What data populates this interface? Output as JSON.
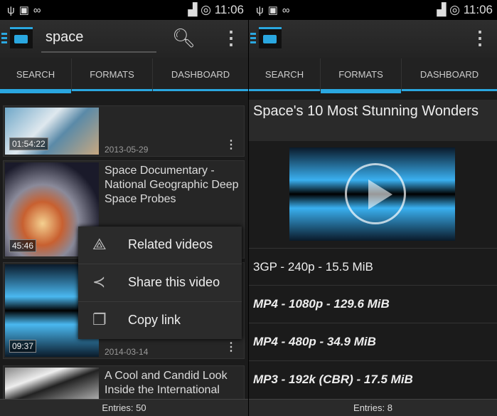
{
  "status": {
    "time": "11:06"
  },
  "left": {
    "search_value": "space",
    "tabs": [
      "SEARCH",
      "FORMATS",
      "DASHBOARD"
    ],
    "active_tab": "SEARCH",
    "items": [
      {
        "title": "",
        "duration": "01:54:22",
        "date": "2013-05-29"
      },
      {
        "title": "Space Documentary - National Geographic Deep Space Probes",
        "duration": "45:46",
        "date": ""
      },
      {
        "title": "",
        "duration": "09:37",
        "date": "2014-03-14"
      },
      {
        "title": "A Cool and Candid Look Inside the International",
        "duration": "",
        "date": ""
      }
    ],
    "context_menu": [
      {
        "icon": "related-icon",
        "label": "Related videos"
      },
      {
        "icon": "share-icon",
        "label": "Share this video"
      },
      {
        "icon": "copy-icon",
        "label": "Copy link"
      }
    ],
    "footer": "Entries: 50"
  },
  "right": {
    "tabs": [
      "SEARCH",
      "FORMATS",
      "DASHBOARD"
    ],
    "active_tab": "FORMATS",
    "video_title": "Space's 10 Most Stunning Wonders",
    "formats": [
      "3GP - 240p - 15.5 MiB",
      "MP4 - 1080p - 129.6 MiB",
      "MP4 - 480p - 34.9 MiB",
      "MP3 - 192k (CBR) - 17.5 MiB"
    ],
    "footer": "Entries: 8"
  },
  "colors": {
    "accent": "#2aa7e0"
  }
}
